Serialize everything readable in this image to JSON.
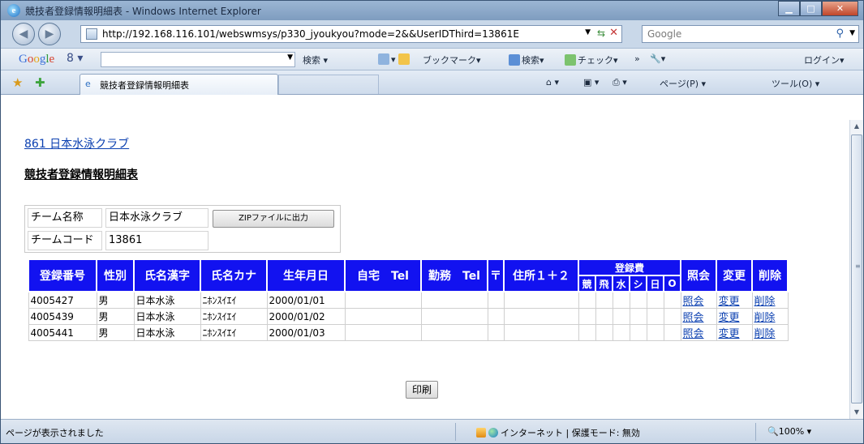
{
  "window": {
    "title": "競技者登録情報明細表 - Windows Internet Explorer",
    "ie_icon_glyph": "e",
    "min_glyph": "▁",
    "max_glyph": "□",
    "close_glyph": "✕"
  },
  "nav": {
    "back_glyph": "◀",
    "forward_glyph": "▶",
    "url": "http://192.168.116.101/webswmsys/p330_jyoukyou?mode=2&&UserIDThird=13861E",
    "search_placeholder": "Google"
  },
  "google_toolbar": {
    "logo": [
      "G",
      "o",
      "o",
      "g",
      "l",
      "e"
    ],
    "extra": "8 ▾",
    "search_label": "検索",
    "bookmarks_label": "ブックマーク▾",
    "search2_label": "検索▾",
    "check_label": "チェック▾",
    "more_label": "»",
    "login_label": "ログイン▾"
  },
  "tabs": {
    "active_label": "競技者登録情報明細表"
  },
  "command_bar": {
    "page_label": "ページ(P) ▾",
    "tools_label": "ツール(O) ▾"
  },
  "page": {
    "club_link": "861 日本水泳クラブ",
    "title": "競技者登録情報明細表",
    "team_name_label": "チーム名称",
    "team_name_value": "日本水泳クラブ",
    "team_code_label": "チームコード",
    "team_code_value": "13861",
    "zip_button": "ZIPファイルに出力",
    "print_button": "印刷"
  },
  "table": {
    "headers": {
      "reg_no": "登録番号",
      "gender": "性別",
      "name_kanji": "氏名漢字",
      "name_kana": "氏名カナ",
      "dob": "生年月日",
      "home_tel": "自宅　Tel",
      "work_tel": "勤務　Tel",
      "postal": "〒",
      "address": "住所１＋２",
      "fee": "登録費",
      "fee_sub": [
        "競",
        "飛",
        "水",
        "シ",
        "日",
        "O"
      ],
      "inquiry": "照会",
      "change": "変更",
      "delete": "削除"
    },
    "rows": [
      {
        "reg_no": "4005427",
        "gender": "男",
        "name_kanji": "日本水泳",
        "name_kana": "ﾆﾎﾝｽｲｴｲ",
        "dob": "2000/01/01",
        "inquiry": "照会",
        "change": "変更",
        "delete": "削除"
      },
      {
        "reg_no": "4005439",
        "gender": "男",
        "name_kanji": "日本水泳",
        "name_kana": "ﾆﾎﾝｽｲｴｲ",
        "dob": "2000/01/02",
        "inquiry": "照会",
        "change": "変更",
        "delete": "削除"
      },
      {
        "reg_no": "4005441",
        "gender": "男",
        "name_kanji": "日本水泳",
        "name_kana": "ﾆﾎﾝｽｲｴｲ",
        "dob": "2000/01/03",
        "inquiry": "照会",
        "change": "変更",
        "delete": "削除"
      }
    ]
  },
  "status": {
    "text": "ページが表示されました",
    "zone": "インターネット | 保護モード: 無効",
    "zoom": "100%"
  }
}
